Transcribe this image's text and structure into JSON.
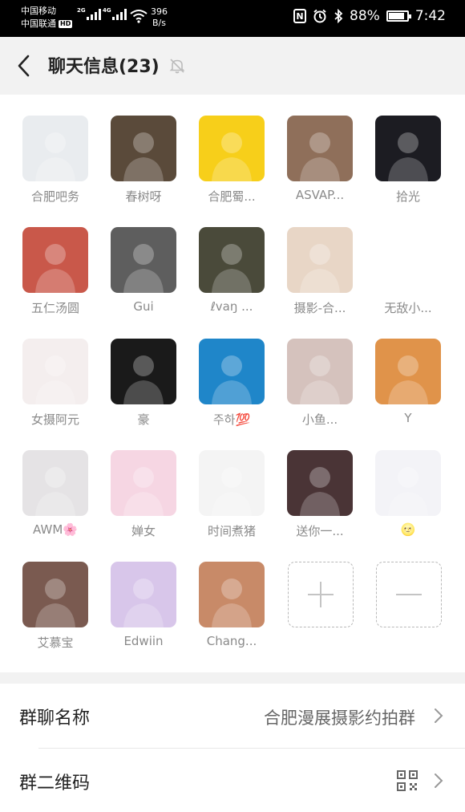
{
  "status_bar": {
    "carrier_1": "中国移动",
    "carrier_2": "中国联通",
    "hd": "HD",
    "sig1_gen": "2G",
    "sig2_gen": "4G",
    "speed_value": "396",
    "speed_unit": "B/s",
    "nfc": "N",
    "battery_pct": "88%",
    "battery_level": 0.88,
    "time": "7:42"
  },
  "header": {
    "title": "聊天信息(23)",
    "back_icon": "chevron-left-icon",
    "mute_icon": "bell-off-icon"
  },
  "members": [
    {
      "name": "合肥吧务",
      "bg": "#e9ecef"
    },
    {
      "name": "春树呀",
      "bg": "#5a4a3a"
    },
    {
      "name": "合肥蜀...",
      "bg": "#f7cf1a"
    },
    {
      "name": "ASVAP...",
      "bg": "#8f6f5a"
    },
    {
      "name": "拾光",
      "bg": "#1c1c22"
    },
    {
      "name": "五仁汤圆",
      "bg": "#c9584a"
    },
    {
      "name": "Gui",
      "bg": "#5e5e5e"
    },
    {
      "name": "ℓvaŋ ...",
      "bg": "#4a4a3a"
    },
    {
      "name": "摄影-合...",
      "bg": "#e8d6c6"
    },
    {
      "name": "无敌小...",
      "bg": "#ffffff"
    },
    {
      "name": "女摄阿元",
      "bg": "#f4eeee"
    },
    {
      "name": "豪",
      "bg": "#1a1a1a"
    },
    {
      "name": "주하💯",
      "bg": "#1f86c9"
    },
    {
      "name": "小鱼...",
      "bg": "#d5c2bd"
    },
    {
      "name": "Y",
      "bg": "#e0934a"
    },
    {
      "name": "AWM🌸",
      "bg": "#e5e3e5"
    },
    {
      "name": "婵女",
      "bg": "#f6d6e3"
    },
    {
      "name": "时间煮猪",
      "bg": "#f4f4f4"
    },
    {
      "name": "送你一...",
      "bg": "#4a3436"
    },
    {
      "name": "🌝",
      "bg": "#f3f3f7"
    },
    {
      "name": "艾慕宝",
      "bg": "#7a5a50"
    },
    {
      "name": "Edwiin",
      "bg": "#d8c6ea"
    },
    {
      "name": "Chang...",
      "bg": "#c88a68"
    }
  ],
  "add_member_icon": "plus-icon",
  "remove_member_icon": "minus-icon",
  "settings": {
    "group_name_label": "群聊名称",
    "group_name_value": "合肥漫展摄影约拍群",
    "qr_label": "群二维码",
    "qr_icon": "qr-code-icon",
    "chevron_icon": "chevron-right-icon"
  }
}
